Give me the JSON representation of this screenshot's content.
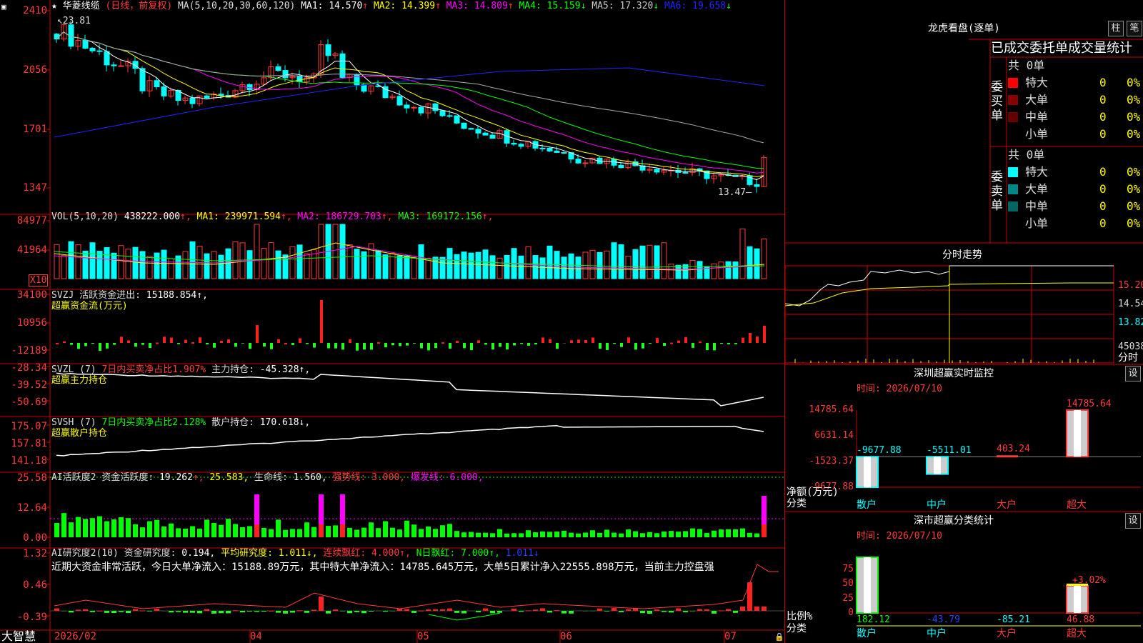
{
  "app": {
    "brand": "大智慧"
  },
  "main": {
    "star": "★",
    "stock": "华菱线缆",
    "mode": "(日线，前复权)",
    "ma_title": "MA(5,10,20,30,60,120)",
    "ma": [
      {
        "label": "MA1:",
        "value": "14.570",
        "arrow": "↑",
        "color": "#ffffff"
      },
      {
        "label": "MA2:",
        "value": "14.399",
        "arrow": "↑",
        "color": "#ffff00"
      },
      {
        "label": "MA3:",
        "value": "14.809",
        "arrow": "↑",
        "color": "#ff00ff"
      },
      {
        "label": "MA4:",
        "value": "15.159",
        "arrow": "↓",
        "color": "#00ff00"
      },
      {
        "label": "MA5:",
        "value": "17.320",
        "arrow": "↓",
        "color": "#cccccc"
      },
      {
        "label": "MA6:",
        "value": "19.658",
        "arrow": "↓",
        "color": "#2222ff"
      }
    ],
    "high_label": "23.81",
    "low_label": "13.47",
    "y_ticks": [
      "2410",
      "2056",
      "1701",
      "1347"
    ]
  },
  "vol": {
    "title": "VOL(5,10,20)",
    "value": "438222.000",
    "ma": [
      {
        "label": "MA1:",
        "value": "239971.594",
        "arrow": "↑",
        "color": "#ffff00"
      },
      {
        "label": "MA2:",
        "value": "186729.703",
        "arrow": "↑",
        "color": "#ff00ff"
      },
      {
        "label": "MA3:",
        "value": "169172.156",
        "arrow": "↑",
        "color": "#00ff00"
      }
    ],
    "y_ticks": [
      "84977",
      "41964"
    ],
    "unit": "X10"
  },
  "svzj": {
    "title": "SVZJ",
    "label": "活跃资金进出:",
    "value": "15188.854",
    "sub": "超赢资金流(万元)",
    "y_ticks": [
      "34100",
      "10956",
      "-12189"
    ]
  },
  "svzl": {
    "title": "SVZL (7)",
    "label": "7日内买卖净占比1.907%",
    "label2": "主力持仓:",
    "value": "-45.328",
    "sub": "超赢主力持仓",
    "y_ticks": [
      "-28.34",
      "-39.52",
      "-50.69"
    ]
  },
  "svsh": {
    "title": "SVSH (7)",
    "label": "7日内买卖净占比2.128%",
    "label2": "散户持仓:",
    "value": "170.618",
    "sub": "超赢散户持仓",
    "y_ticks": [
      "175.07",
      "157.81",
      "141.18"
    ]
  },
  "ai1": {
    "title": "AI活跃度2",
    "label": "资金活跃度:",
    "value": "19.262",
    "v2": "25.583",
    "label3": "生命线:",
    "v3": "1.560",
    "label4": "强势线:",
    "v4": "3.000",
    "label5": "爆发线:",
    "v5": "6.000",
    "y_ticks": [
      "25.58",
      "12.64",
      "0.00"
    ]
  },
  "ai2": {
    "title": "AI研究度2(10)",
    "label": "资金研究度:",
    "value": "0.194",
    "label2": "平均研究度:",
    "v2": "1.011",
    "label3": "连续飘红:",
    "v3": "4.000",
    "label4": "N日飘红:",
    "v4": "7.000",
    "v5": "1.011",
    "comment": "近期大资金非常活跃，今日大单净流入：15188.89万元，其中特大单净流入：14785.645万元，大单5日累计净入22555.898万元，当前主力控盘强",
    "y_ticks": [
      "1.32",
      "0.46",
      "-0.39"
    ]
  },
  "xaxis": {
    "labels": [
      "2026/02",
      "04",
      "05",
      "06",
      "07"
    ]
  },
  "lhb": {
    "title": "龙虎看盘(逐单)",
    "btn1": "柱",
    "btn2": "笔",
    "header": "已成交委托单成交量统计",
    "buy_side": "委买单",
    "sell_side": "委卖单",
    "buy_total": "共 0单",
    "sell_total": "共 0单",
    "rows": [
      {
        "name": "特大",
        "count": "0",
        "pct": "0%"
      },
      {
        "name": "大单",
        "count": "0",
        "pct": "0%"
      },
      {
        "name": "中单",
        "count": "0",
        "pct": "0%"
      },
      {
        "name": "小单",
        "count": "0",
        "pct": "0%"
      }
    ],
    "buy_colors": [
      "#ff0000",
      "#880000",
      "#660000",
      ""
    ],
    "sell_colors": [
      "#00ffff",
      "#008888",
      "#006666",
      ""
    ]
  },
  "fenshi": {
    "title": "分时走势",
    "y_ticks": [
      "15.20",
      "14.54",
      "13.82",
      "45038"
    ],
    "unit": "分时"
  },
  "sz": {
    "title": "深圳超赢实时监控",
    "btn": "设",
    "time": "时间: 2026/07/10",
    "y_ticks": [
      "14785.64",
      "6631.14",
      "-1523.37",
      "-9677.88"
    ],
    "axis_title": "净额(万元)",
    "axis_sub": "分类",
    "cats": [
      "散户",
      "中户",
      "大户",
      "超大"
    ],
    "chart_data": {
      "type": "bar",
      "categories": [
        "散户",
        "中户",
        "大户",
        "超大"
      ],
      "values": [
        -9677.88,
        -5511.01,
        403.24,
        14785.64
      ],
      "labels": [
        "-9677.88",
        "-5511.01",
        "403.24",
        "14785.64"
      ],
      "ylim": [
        -9677.88,
        14785.64
      ]
    }
  },
  "sc": {
    "title": "深市超赢分类统计",
    "btn": "设",
    "time": "时间: 2026/07/10",
    "y_ticks": [
      "75",
      "50",
      "25",
      "0"
    ],
    "axis_title": "比例%",
    "axis_sub": "分类",
    "cats": [
      "散户",
      "中户",
      "大户",
      "超大"
    ],
    "top_label": "+3.02%",
    "chart_data": {
      "type": "bar",
      "categories": [
        "散户",
        "中户",
        "大户",
        "超大"
      ],
      "values": [
        182.12,
        -43.79,
        -85.21,
        46.88
      ],
      "labels": [
        "182.12",
        "-43.79",
        "-85.21",
        "46.88"
      ],
      "ylim": [
        0,
        75
      ]
    }
  }
}
